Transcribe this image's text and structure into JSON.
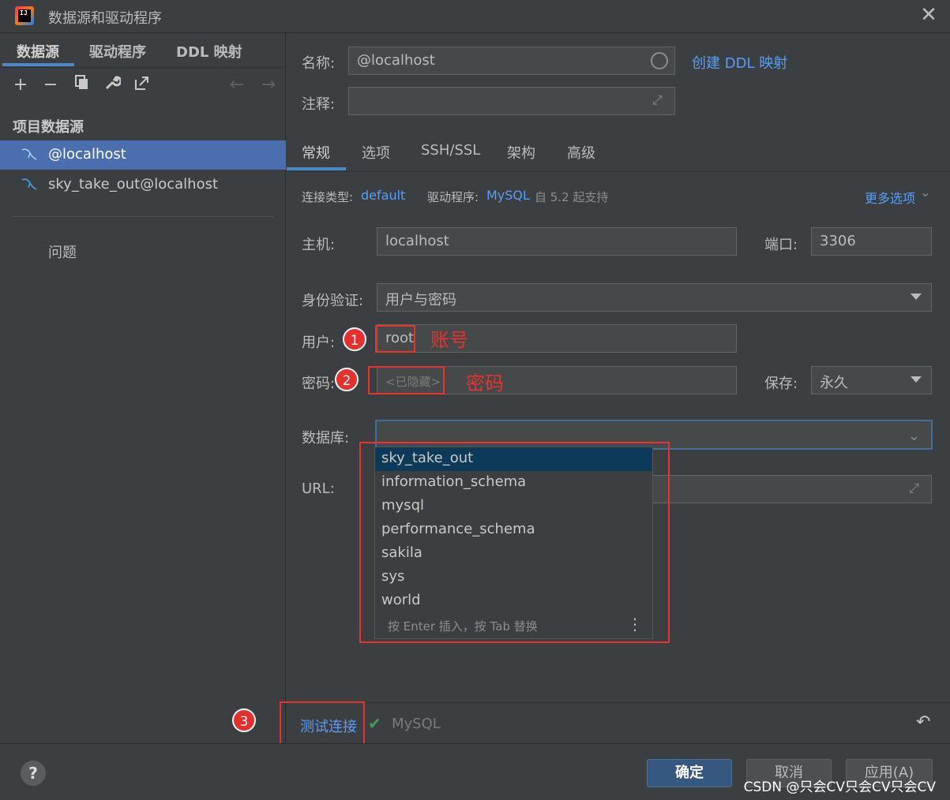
{
  "window": {
    "title": "数据源和驱动程序",
    "close": "✕",
    "app_icon_text": "IJ"
  },
  "left": {
    "tabs": [
      "数据源",
      "驱动程序",
      "DDL 映射"
    ],
    "section_title": "项目数据源",
    "datasources": [
      "@localhost",
      "sky_take_out@localhost"
    ],
    "problems": "问题"
  },
  "form": {
    "name_label": "名称:",
    "name_value": "@localhost",
    "create_ddl_link": "创建 DDL 映射",
    "comment_label": "注释:",
    "tabs": [
      "常规",
      "选项",
      "SSH/SSL",
      "架构",
      "高级"
    ],
    "conn_type_label": "连接类型:",
    "conn_type_value": "default",
    "driver_label": "驱动程序:",
    "driver_value": "MySQL",
    "driver_note": "自 5.2 起支持",
    "more_options": "更多选项",
    "host_label": "主机:",
    "host_value": "localhost",
    "port_label": "端口:",
    "port_value": "3306",
    "auth_label": "身份验证:",
    "auth_value": "用户与密码",
    "user_label": "用户:",
    "user_value": "root",
    "password_label": "密码:",
    "password_value": "<已隐藏>",
    "save_label": "保存:",
    "save_value": "永久",
    "database_label": "数据库:",
    "url_label": "URL:"
  },
  "annotations": {
    "num1": "1",
    "text1": "账号",
    "num2": "2",
    "text2": "密码",
    "num3": "3"
  },
  "popup": {
    "items": [
      "sky_take_out",
      "information_schema",
      "mysql",
      "performance_schema",
      "sakila",
      "sys",
      "world"
    ],
    "footer": "按 Enter 插入，按 Tab 替换"
  },
  "bottom": {
    "test_connection": "测试连接",
    "status_driver": "MySQL"
  },
  "footer": {
    "help": "?",
    "ok": "确定",
    "cancel": "取消",
    "apply": "应用(A)",
    "watermark": "CSDN @只会CV只会CV只会CV"
  }
}
